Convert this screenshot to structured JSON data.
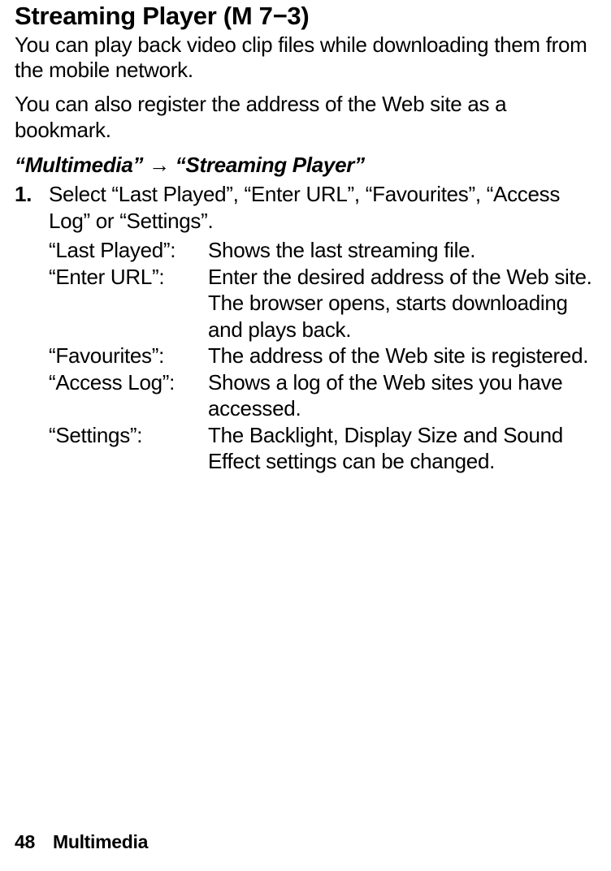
{
  "heading": "Streaming Player (M 7−3)",
  "intro1": "You can play back video clip files while downloading them from the mobile network.",
  "intro2": "You can also register the address of the Web site as a bookmark.",
  "navpath": "“Multimedia” → “Streaming Player”",
  "step": {
    "num": "1.",
    "text": "Select “Last Played”, “Enter URL”, “Favourites”, “Access Log” or “Settings”."
  },
  "defs": [
    {
      "term": "“Last Played”:",
      "desc": "Shows the last streaming file."
    },
    {
      "term": "“Enter URL”:",
      "desc": "Enter the desired address of the Web site. The browser opens, starts downloading and plays back."
    },
    {
      "term": "“Favourites”:",
      "desc": "The address of the Web site is registered."
    },
    {
      "term": "“Access Log”:",
      "desc": "Shows a log of the Web sites you have accessed."
    },
    {
      "term": "“Settings”:",
      "desc": "The Backlight, Display Size and Sound Effect settings can be changed."
    }
  ],
  "footer": {
    "page": "48",
    "section": "Multimedia"
  }
}
